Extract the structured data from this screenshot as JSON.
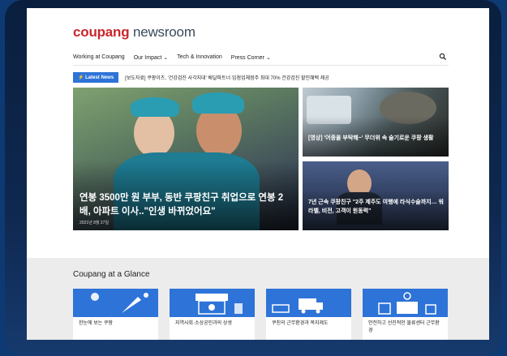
{
  "logo": {
    "brand": "coupang",
    "suffix": " newsroom"
  },
  "nav": {
    "items": [
      "Working at Coupang",
      "Our Impact ⌄",
      "Tech & Innovation",
      "Press Corner ⌄"
    ]
  },
  "ticker": {
    "badge": "⚡ Latest News",
    "text": "[보도자료] 쿠팡이츠, '건강검진 사각지대' 배달파트너·입점업체점주 최대 70% 건강검진 할인혜택 제공"
  },
  "hero": {
    "title": "연봉 3500만 원 부부, 동반 쿠팡친구 취업으로 연봉 2배, 아파트 이사..\"인생 바뀌었어요\"",
    "date": "2021년 8월 27일"
  },
  "side": [
    {
      "title": "[영상] '어종을 부탁해~' 무더위 속 술기로운 쿠팡 생활"
    },
    {
      "title": "7년 근속 쿠팡친구 \"2주 제주도 여행에 라식수술까지… 워라벨, 비전, 고객이 원동력\""
    }
  ],
  "glance": {
    "title": "Coupang at a Glance",
    "cards": [
      "한눈에 보는 쿠팡",
      "지역사회·소상공인과의 상생",
      "쿠친의 근무환경과 복지제도",
      "안전하고 선진적인 물류센터 근무환경"
    ]
  },
  "colors": {
    "brand_red": "#c9272c",
    "accent_blue": "#2e73d8"
  }
}
